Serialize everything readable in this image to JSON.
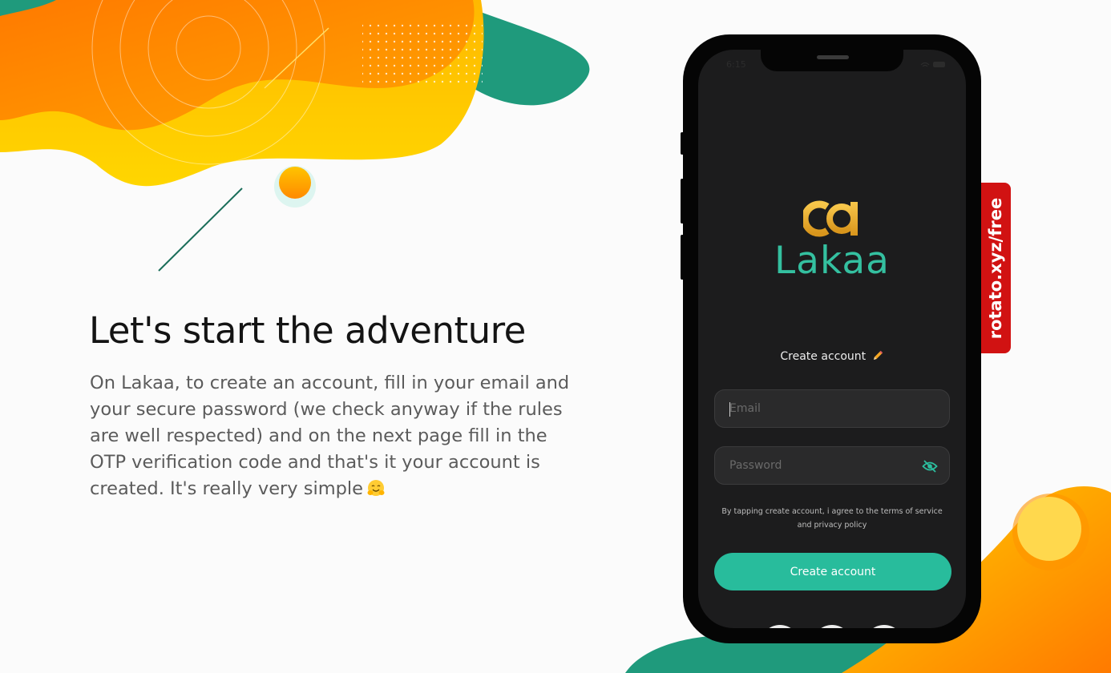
{
  "headline": "Let's start the adventure",
  "description": "On Lakaa, to create an account, fill in your email and your secure password (we check anyway if the rules are well respected) and on the next page fill in the OTP verification code and that's it your account is created. It's really very simple",
  "description_emoji_icon": "hugging-face-emoji-icon",
  "watermark": "rotato.xyz/free",
  "phone": {
    "status_time": "6:15",
    "brand_name": "Lakaa",
    "logo_icon": "lakaa-logo-icon",
    "create_title": "Create account",
    "create_title_icon": "pencil-emoji-icon",
    "email": {
      "placeholder": "Email",
      "value": ""
    },
    "password": {
      "placeholder": "Password",
      "value": "",
      "toggle_icon": "eye-off-icon"
    },
    "terms_text": "By tapping create account, i agree to the terms of service and privacy policy",
    "create_button": "Create account",
    "social_icons": [
      "google-icon",
      "facebook-icon",
      "twitter-icon"
    ]
  },
  "colors": {
    "accent": "#28bc9c",
    "brand_text": "#34c0a0",
    "logo_gold": "#f2b632",
    "watermark_red": "#d11212",
    "orange": "#ff8a00",
    "yellow": "#ffd000",
    "teal_shape": "#1f9a7c"
  }
}
